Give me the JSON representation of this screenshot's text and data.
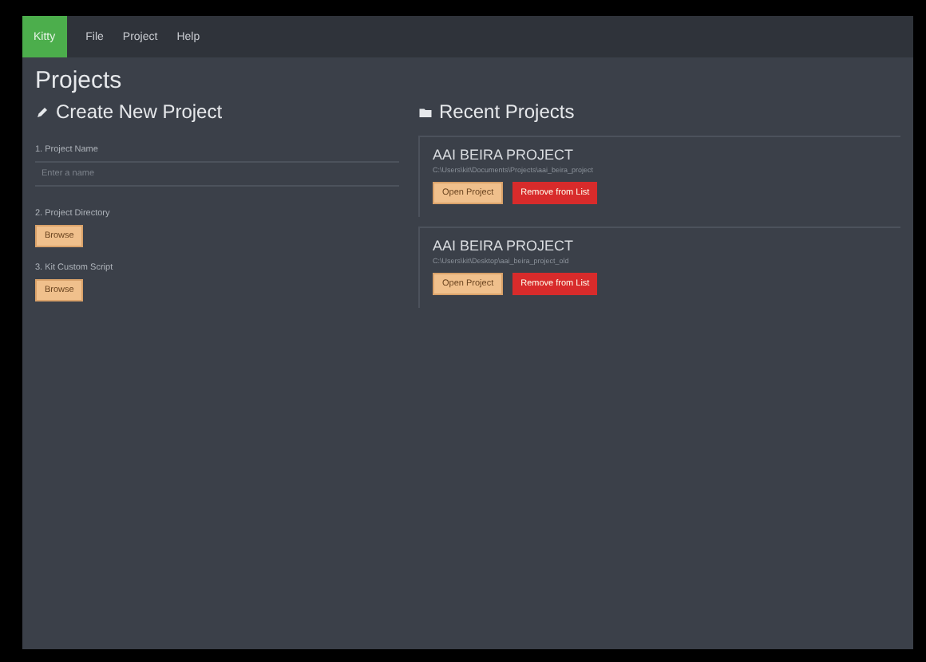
{
  "menu": {
    "brand": "Kitty",
    "items": [
      "File",
      "Project",
      "Help"
    ]
  },
  "title": "Projects",
  "create": {
    "heading": "Create New Project",
    "name_label": "1. Project Name",
    "name_placeholder": "Enter a name",
    "dir_label": "2. Project Directory",
    "dir_button": "Browse",
    "script_label": "3. Kit Custom Script",
    "script_button": "Browse"
  },
  "recent": {
    "heading": "Recent Projects",
    "projects": [
      {
        "name": "AAI BEIRA PROJECT",
        "path": "C:\\Users\\kit\\Documents\\Projects\\aai_beira_project",
        "open": "Open Project",
        "remove": "Remove from List"
      },
      {
        "name": "AAI BEIRA PROJECT",
        "path": "C:\\Users\\kit\\Desktop\\aai_beira_project_old",
        "open": "Open Project",
        "remove": "Remove from List"
      }
    ]
  }
}
